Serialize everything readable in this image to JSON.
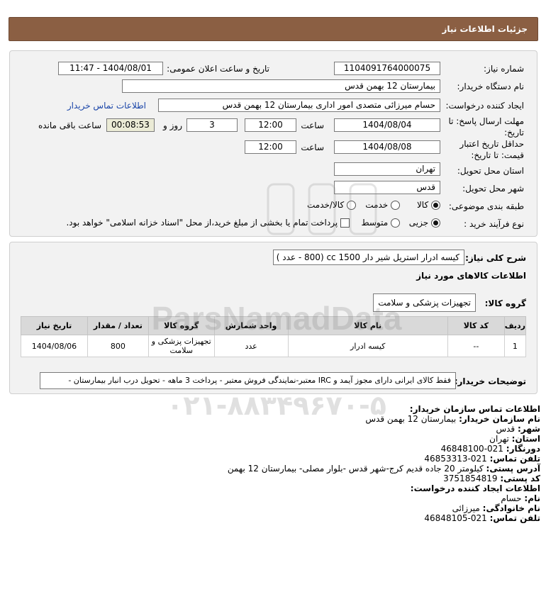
{
  "window": {
    "title": "جزئیات اطلاعات نیاز"
  },
  "header": {
    "need_number_label": "شماره نیاز:",
    "need_number": "1104091764000075",
    "announce_label": "تاریخ و ساعت اعلان عمومی:",
    "announce_value": "1404/08/01 - 11:47",
    "buyer_org_label": "نام دستگاه خریدار:",
    "buyer_org": "بیمارستان 12 بهمن قدس",
    "creator_label": "ایجاد کننده درخواست:",
    "creator": "حسام میرزائی متصدی امور اداری بیمارستان 12 بهمن قدس",
    "buyer_contact_link": "اطلاعات تماس خریدار",
    "deadline_label_1": "مهلت ارسال پاسخ: تا",
    "deadline_label_2": "تاریخ:",
    "deadline_date": "1404/08/04",
    "time_label": "ساعت",
    "deadline_time": "12:00",
    "days_value": "3",
    "days_label": "روز و",
    "remaining_time": "00:08:53",
    "remaining_label": "ساعت باقی مانده",
    "validity_label_1": "حداقل تاریخ اعتبار",
    "validity_label_2": "قیمت: تا تاریخ:",
    "validity_date": "1404/08/08",
    "validity_time_label": "ساعت",
    "validity_time": "12:00",
    "province_label": "استان محل تحویل:",
    "province": "تهران",
    "city_label": "شهر محل تحویل:",
    "city": "قدس",
    "category_label": "طبقه بندی موضوعی:",
    "category_options": [
      "کالا",
      "خدمت",
      "کالا/خدمت"
    ],
    "process_label": "نوع فرآیند خرید :",
    "process_options": [
      "جزیی",
      "متوسط"
    ],
    "payment_note": "پرداخت تمام یا بخشی از مبلغ خرید،از محل \"اسناد خزانه اسلامی\" خواهد بود."
  },
  "summary": {
    "label": "شرح کلی نیاز:",
    "value": "کیسه ادرار استریل شیر دار 1500 cc (800 - عدد )",
    "goods_info_title": "اطلاعات کالاهای مورد نیاز",
    "group_label": "گروه کالا:",
    "group_value": "تجهیزات پزشکی و سلامت"
  },
  "table": {
    "headers": [
      "ردیف",
      "کد کالا",
      "نام کالا",
      "واحد شمارش",
      "گروه کالا",
      "تعداد / مقدار",
      "تاریخ نیاز"
    ],
    "rows": [
      [
        "1",
        "--",
        "کیسه ادرار",
        "عدد",
        "تجهیزات پزشکی و سلامت",
        "800",
        "1404/08/06"
      ]
    ]
  },
  "notes": {
    "label": "توضیحات خریدار:",
    "value": "فقط کالای ایرانی دارای مجوز آیمد و IRC معتبر-نمایندگی فروش معتبر - پرداخت 3 ماهه - تحویل درب انبار بیمارستان -"
  },
  "contact": {
    "org_title": "اطلاعات تماس سازمان خریدار:",
    "buyer_name_label": "نام سازمان خریدار:",
    "buyer_name": "بیمارستان 12 بهمن قدس",
    "city_label": "شهر:",
    "city": "قدس",
    "province_label": "استان:",
    "province": "تهران",
    "fax_label": "دورنگار:",
    "fax": "021-46848100",
    "phone_label": "تلفن تماس:",
    "phone": "021-46853313",
    "address_label": "آدرس پستی:",
    "address": "کیلومتر 20 جاده قدیم کرج-شهر قدس -بلوار مصلی- بیمارستان 12 بهمن",
    "postal_label": "کد پستی:",
    "postal": "3751854819",
    "creator_title": "اطلاعات ایجاد کننده درخواست:",
    "first_name_label": "نام:",
    "first_name": "حسام",
    "last_name_label": "نام خانوادگی:",
    "last_name": "میرزائی",
    "creator_phone_label": "تلفن تماس:",
    "creator_phone": "021-46848105"
  },
  "watermark": {
    "brand": "ParsNamadData",
    "phone": "۰۲۱-۸۸۳۴۹۶۷۰-۵"
  },
  "colors": {
    "titlebar": "#8b5f43",
    "panel": "#f2f2f2",
    "link": "#1a45a8",
    "timer": "#ebebd6"
  }
}
